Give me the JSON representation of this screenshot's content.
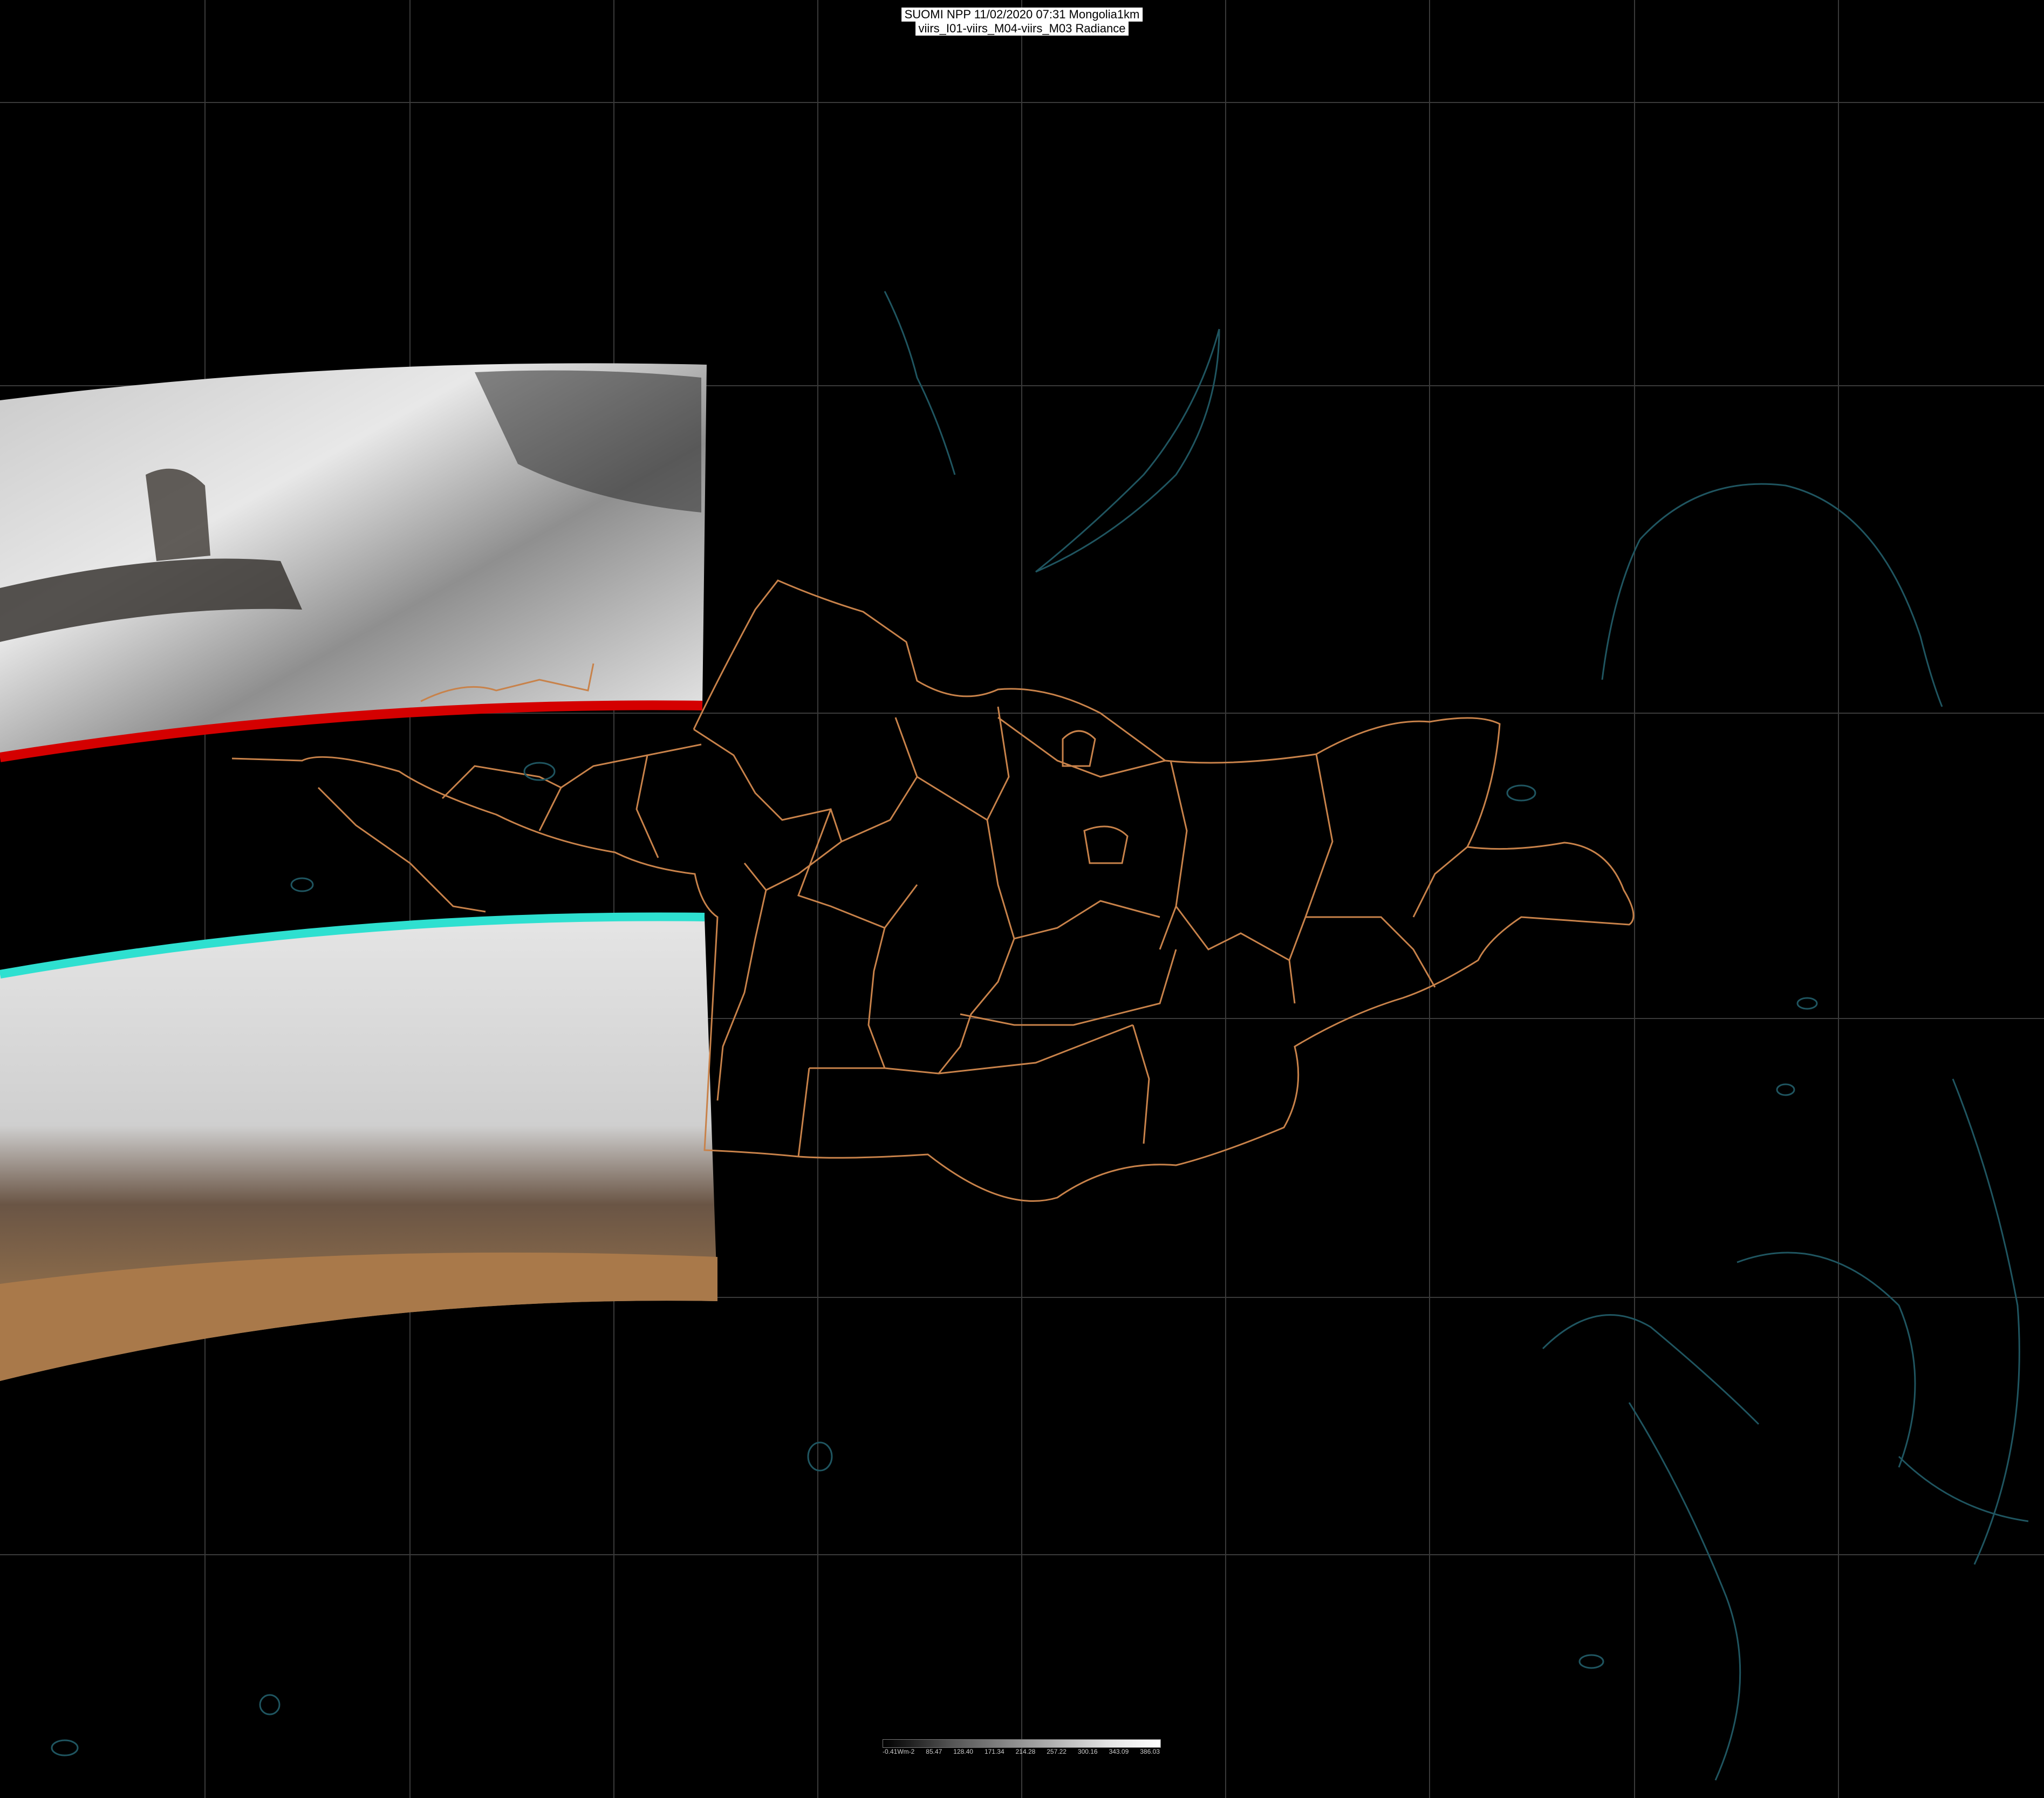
{
  "header": {
    "line1": "SUOMI NPP 11/02/2020 07:31 Mongolia1km",
    "line2": "viirs_I01-viirs_M04-viirs_M03 Radiance"
  },
  "colorbar": {
    "labels": [
      "-0.41Wm-2",
      "85.47",
      "128.40",
      "171.34",
      "214.28",
      "257.22",
      "300.16",
      "343.09",
      "386.03"
    ]
  },
  "map": {
    "grid_color": "#3a3a3a",
    "border_color": "#c8824a",
    "coast_color": "#1f5560",
    "swath_top_edge_color": "#d40000",
    "swath_bottom_edge_color": "#2ee0d0"
  }
}
